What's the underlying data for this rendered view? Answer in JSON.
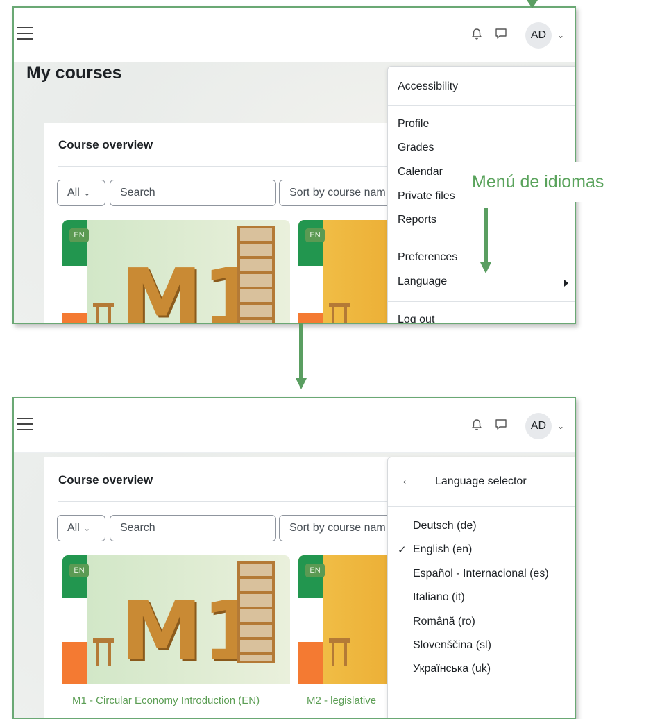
{
  "navbar": {
    "avatar_initials": "AD"
  },
  "panel1": {
    "page_title": "My courses",
    "card_title": "Course overview",
    "filter_all": "All",
    "search_placeholder": "Search",
    "sort_label": "Sort by course nam",
    "badge": "EN",
    "user_menu": {
      "items": [
        "Accessibility",
        "Profile",
        "Grades",
        "Calendar",
        "Private files",
        "Reports",
        "Preferences",
        "Language",
        "Log out"
      ]
    }
  },
  "annotation": {
    "label": "Menú de idiomas",
    "color": "#5aa35c"
  },
  "panel2": {
    "card_title": "Course overview",
    "filter_all": "All",
    "search_placeholder": "Search",
    "sort_label": "Sort by course nam",
    "badge": "EN",
    "language_menu": {
      "title": "Language selector",
      "languages": [
        "Deutsch (de)",
        "English (en)",
        "Español - Internacional (es)",
        "Italiano (it)",
        "Română (ro)",
        "Slovenščina (sl)",
        "Українська (uk)"
      ],
      "selected": "English (en)"
    },
    "courses": [
      "M1 - Circular Economy Introduction (EN)",
      "M2 - legislative"
    ]
  },
  "colors": {
    "frame_border": "#6aa874",
    "link_green": "#5c9e55",
    "flag_green": "#22964f",
    "flag_orange": "#f47a32"
  }
}
